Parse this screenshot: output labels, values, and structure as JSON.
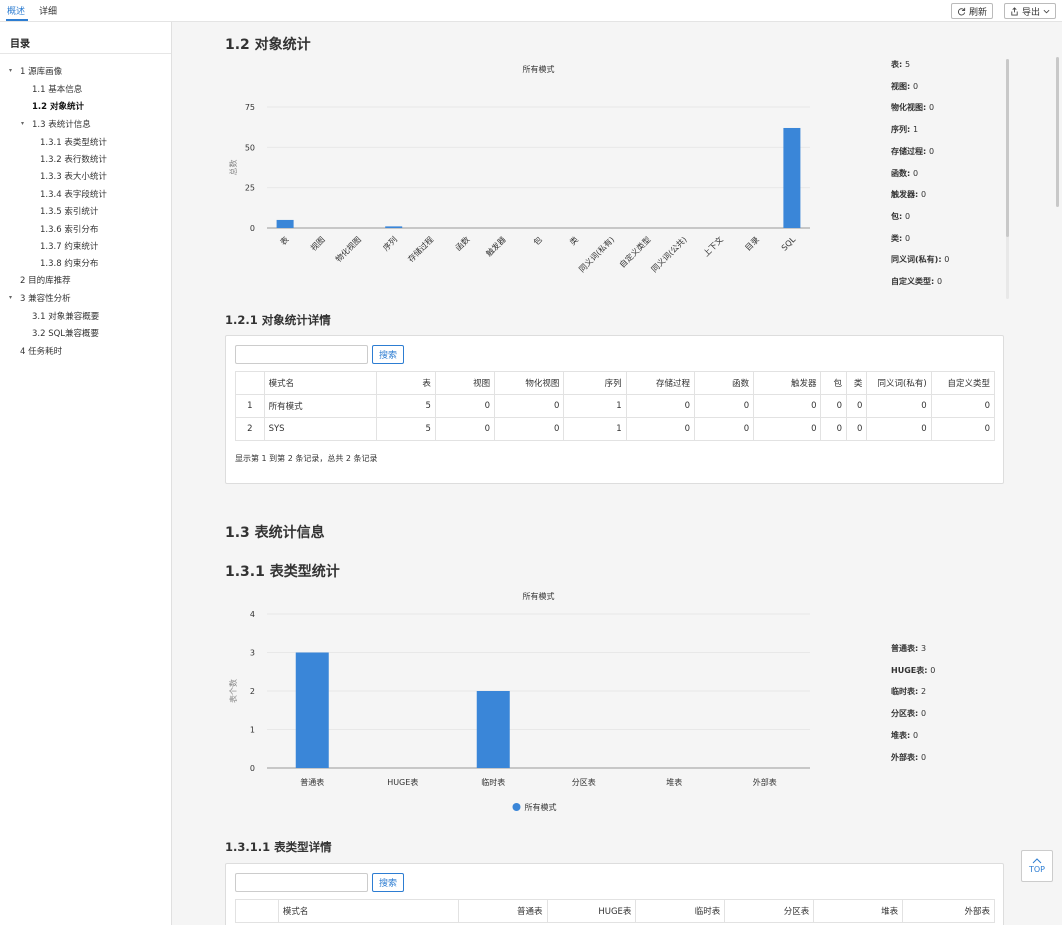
{
  "topbar": {
    "tabs": [
      "概述",
      "详细"
    ],
    "refresh_label": "刷新",
    "export_label": "导出"
  },
  "toc": {
    "title": "目录",
    "items": [
      {
        "label": "1  源库画像",
        "level": 0,
        "expanded": true
      },
      {
        "label": "1.1  基本信息",
        "level": 1
      },
      {
        "label": "1.2  对象统计",
        "level": 1,
        "active": true
      },
      {
        "label": "1.3  表统计信息",
        "level": 1,
        "expanded": true
      },
      {
        "label": "1.3.1  表类型统计",
        "level": 2
      },
      {
        "label": "1.3.2  表行数统计",
        "level": 2
      },
      {
        "label": "1.3.3  表大小统计",
        "level": 2
      },
      {
        "label": "1.3.4  表字段统计",
        "level": 2
      },
      {
        "label": "1.3.5  索引统计",
        "level": 2
      },
      {
        "label": "1.3.6  索引分布",
        "level": 2
      },
      {
        "label": "1.3.7  约束统计",
        "level": 2
      },
      {
        "label": "1.3.8  约束分布",
        "level": 2
      },
      {
        "label": "2  目的库推荐",
        "level": 0
      },
      {
        "label": "3  兼容性分析",
        "level": 0,
        "expanded": true
      },
      {
        "label": "3.1  对象兼容概要",
        "level": 1
      },
      {
        "label": "3.2  SQL兼容概要",
        "level": 1
      },
      {
        "label": "4  任务耗时",
        "level": 0
      }
    ]
  },
  "section_12": {
    "heading": "1.2  对象统计",
    "stats": [
      {
        "label": "表",
        "value": "5"
      },
      {
        "label": "视图",
        "value": "0"
      },
      {
        "label": "物化视图",
        "value": "0"
      },
      {
        "label": "序列",
        "value": "1"
      },
      {
        "label": "存储过程",
        "value": "0"
      },
      {
        "label": "函数",
        "value": "0"
      },
      {
        "label": "触发器",
        "value": "0"
      },
      {
        "label": "包",
        "value": "0"
      },
      {
        "label": "类",
        "value": "0"
      },
      {
        "label": "同义词(私有)",
        "value": "0"
      },
      {
        "label": "自定义类型",
        "value": "0"
      }
    ]
  },
  "section_121": {
    "heading": "1.2.1  对象统计详情",
    "search_label": "搜索",
    "columns": [
      "",
      "模式名",
      "表",
      "视图",
      "物化视图",
      "序列",
      "存储过程",
      "函数",
      "触发器",
      "包",
      "类",
      "同义词(私有)",
      "自定义类型"
    ],
    "rows": [
      [
        "1",
        "所有模式",
        "5",
        "0",
        "0",
        "1",
        "0",
        "0",
        "0",
        "0",
        "0",
        "0",
        "0"
      ],
      [
        "2",
        "SYS",
        "5",
        "0",
        "0",
        "1",
        "0",
        "0",
        "0",
        "0",
        "0",
        "0",
        "0"
      ]
    ],
    "footer": "显示第 1 到第 2 条记录，总共 2 条记录"
  },
  "section_13": {
    "heading": "1.3  表统计信息"
  },
  "section_131": {
    "heading": "1.3.1  表类型统计",
    "stats": [
      {
        "label": "普通表",
        "value": "3"
      },
      {
        "label": "HUGE表",
        "value": "0"
      },
      {
        "label": "临时表",
        "value": "2"
      },
      {
        "label": "分区表",
        "value": "0"
      },
      {
        "label": "堆表",
        "value": "0"
      },
      {
        "label": "外部表",
        "value": "0"
      }
    ]
  },
  "section_1311": {
    "heading": "1.3.1.1  表类型详情",
    "search_label": "搜索",
    "columns": [
      "",
      "模式名",
      "普通表",
      "HUGE表",
      "临时表",
      "分区表",
      "堆表",
      "外部表"
    ]
  },
  "top_button": "TOP",
  "colors": {
    "accent": "#2d7dd2",
    "bar": "#3a86d8"
  },
  "chart_data": [
    {
      "type": "bar",
      "title": "所有模式",
      "ylabel": "总数",
      "xlabel": "",
      "ylim": [
        0,
        75
      ],
      "yticks": [
        0,
        25,
        50,
        75
      ],
      "categories": [
        "表",
        "视图",
        "物化视图",
        "序列",
        "存储过程",
        "函数",
        "触发器",
        "包",
        "类",
        "同义词(私有)",
        "自定义类型",
        "同义词(公共)",
        "上下文",
        "目录",
        "SQL"
      ],
      "series": [
        {
          "name": "所有模式",
          "values": [
            5,
            0,
            0,
            1,
            0,
            0,
            0,
            0,
            0,
            0,
            0,
            0,
            0,
            0,
            62
          ]
        }
      ],
      "legend": "bottom",
      "grid": true
    },
    {
      "type": "bar",
      "title": "所有模式",
      "ylabel": "表个数",
      "xlabel": "",
      "ylim": [
        0,
        4
      ],
      "yticks": [
        0,
        1,
        2,
        3,
        4
      ],
      "categories": [
        "普通表",
        "HUGE表",
        "临时表",
        "分区表",
        "堆表",
        "外部表"
      ],
      "series": [
        {
          "name": "所有模式",
          "values": [
            3,
            0,
            2,
            0,
            0,
            0
          ]
        }
      ],
      "legend": "bottom",
      "grid": true
    }
  ]
}
